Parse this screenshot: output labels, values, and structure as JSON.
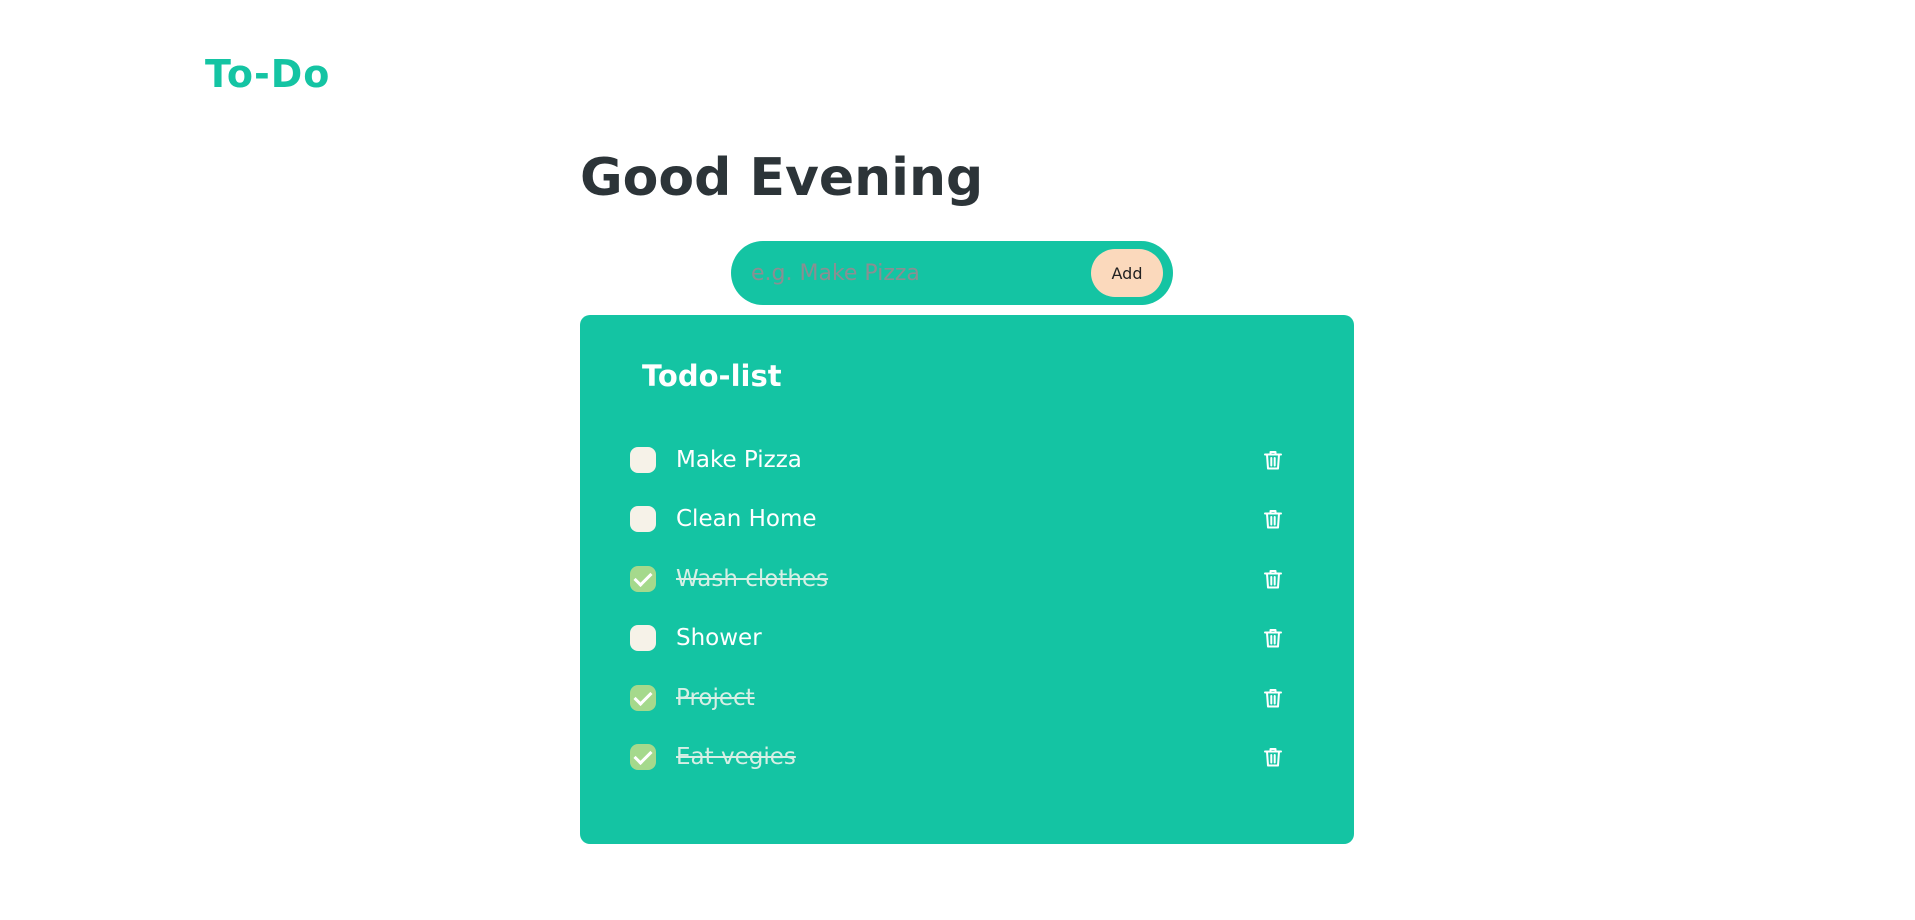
{
  "brand": {
    "title": "To-Do"
  },
  "greeting": "Good Evening",
  "add_form": {
    "placeholder": "e.g. Make Pizza",
    "value": "",
    "button_label": "Add"
  },
  "list": {
    "title": "Todo-list",
    "items": [
      {
        "label": "Make Pizza",
        "done": false
      },
      {
        "label": "Clean Home",
        "done": false
      },
      {
        "label": "Wash clothes",
        "done": true
      },
      {
        "label": "Shower",
        "done": false
      },
      {
        "label": "Project",
        "done": true
      },
      {
        "label": "Eat vegies",
        "done": true
      }
    ]
  },
  "icons": {
    "delete": "trash-icon",
    "checked": "checkmark-icon"
  },
  "colors": {
    "accent": "#14c4a3",
    "heading": "#2c3438",
    "add_button": "#fbd9bc",
    "checkbox_unchecked": "#f6f2e8",
    "checkbox_checked": "#a5d98c"
  }
}
